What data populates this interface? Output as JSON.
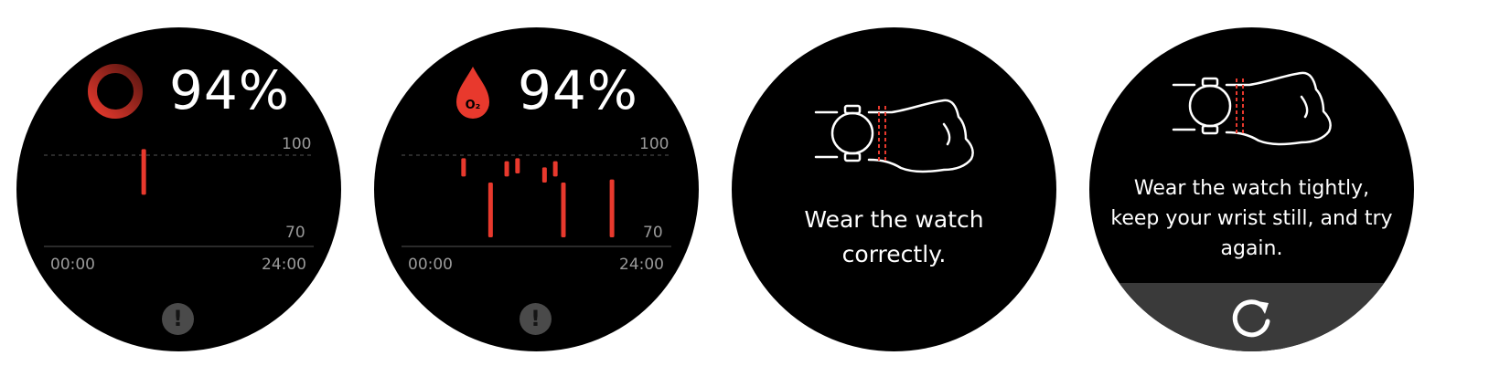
{
  "screens": [
    {
      "value": "94%",
      "axis_max": "100",
      "axis_min": "70",
      "time_start": "00:00",
      "time_end": "24:00",
      "icon": "progress-ring-icon",
      "bars": [
        {
          "t": 0.37,
          "hi": 102,
          "lo": 87
        }
      ]
    },
    {
      "value": "94%",
      "o2_label": "O₂",
      "axis_max": "100",
      "axis_min": "70",
      "time_start": "00:00",
      "time_end": "24:00",
      "icon": "blood-drop-icon",
      "bars": [
        {
          "t": 0.23,
          "hi": 99,
          "lo": 93
        },
        {
          "t": 0.33,
          "hi": 91,
          "lo": 73
        },
        {
          "t": 0.39,
          "hi": 98,
          "lo": 93
        },
        {
          "t": 0.43,
          "hi": 99,
          "lo": 94
        },
        {
          "t": 0.53,
          "hi": 96,
          "lo": 91
        },
        {
          "t": 0.57,
          "hi": 98,
          "lo": 93
        },
        {
          "t": 0.6,
          "hi": 91,
          "lo": 73
        },
        {
          "t": 0.78,
          "hi": 92,
          "lo": 73
        }
      ]
    },
    {
      "message": "Wear the watch correctly.",
      "icon": "wrist-watch-icon"
    },
    {
      "message": "Wear the watch tightly, keep your wrist still, and try again.",
      "icon": "wrist-watch-icon",
      "retry_icon": "refresh-icon"
    }
  ],
  "colors": {
    "accent": "#e8392d",
    "ring_dark": "#6b1a14",
    "muted_text": "#9a9a9a",
    "button_bg": "#4a4a4a",
    "retry_bar": "#3a3a3a"
  }
}
